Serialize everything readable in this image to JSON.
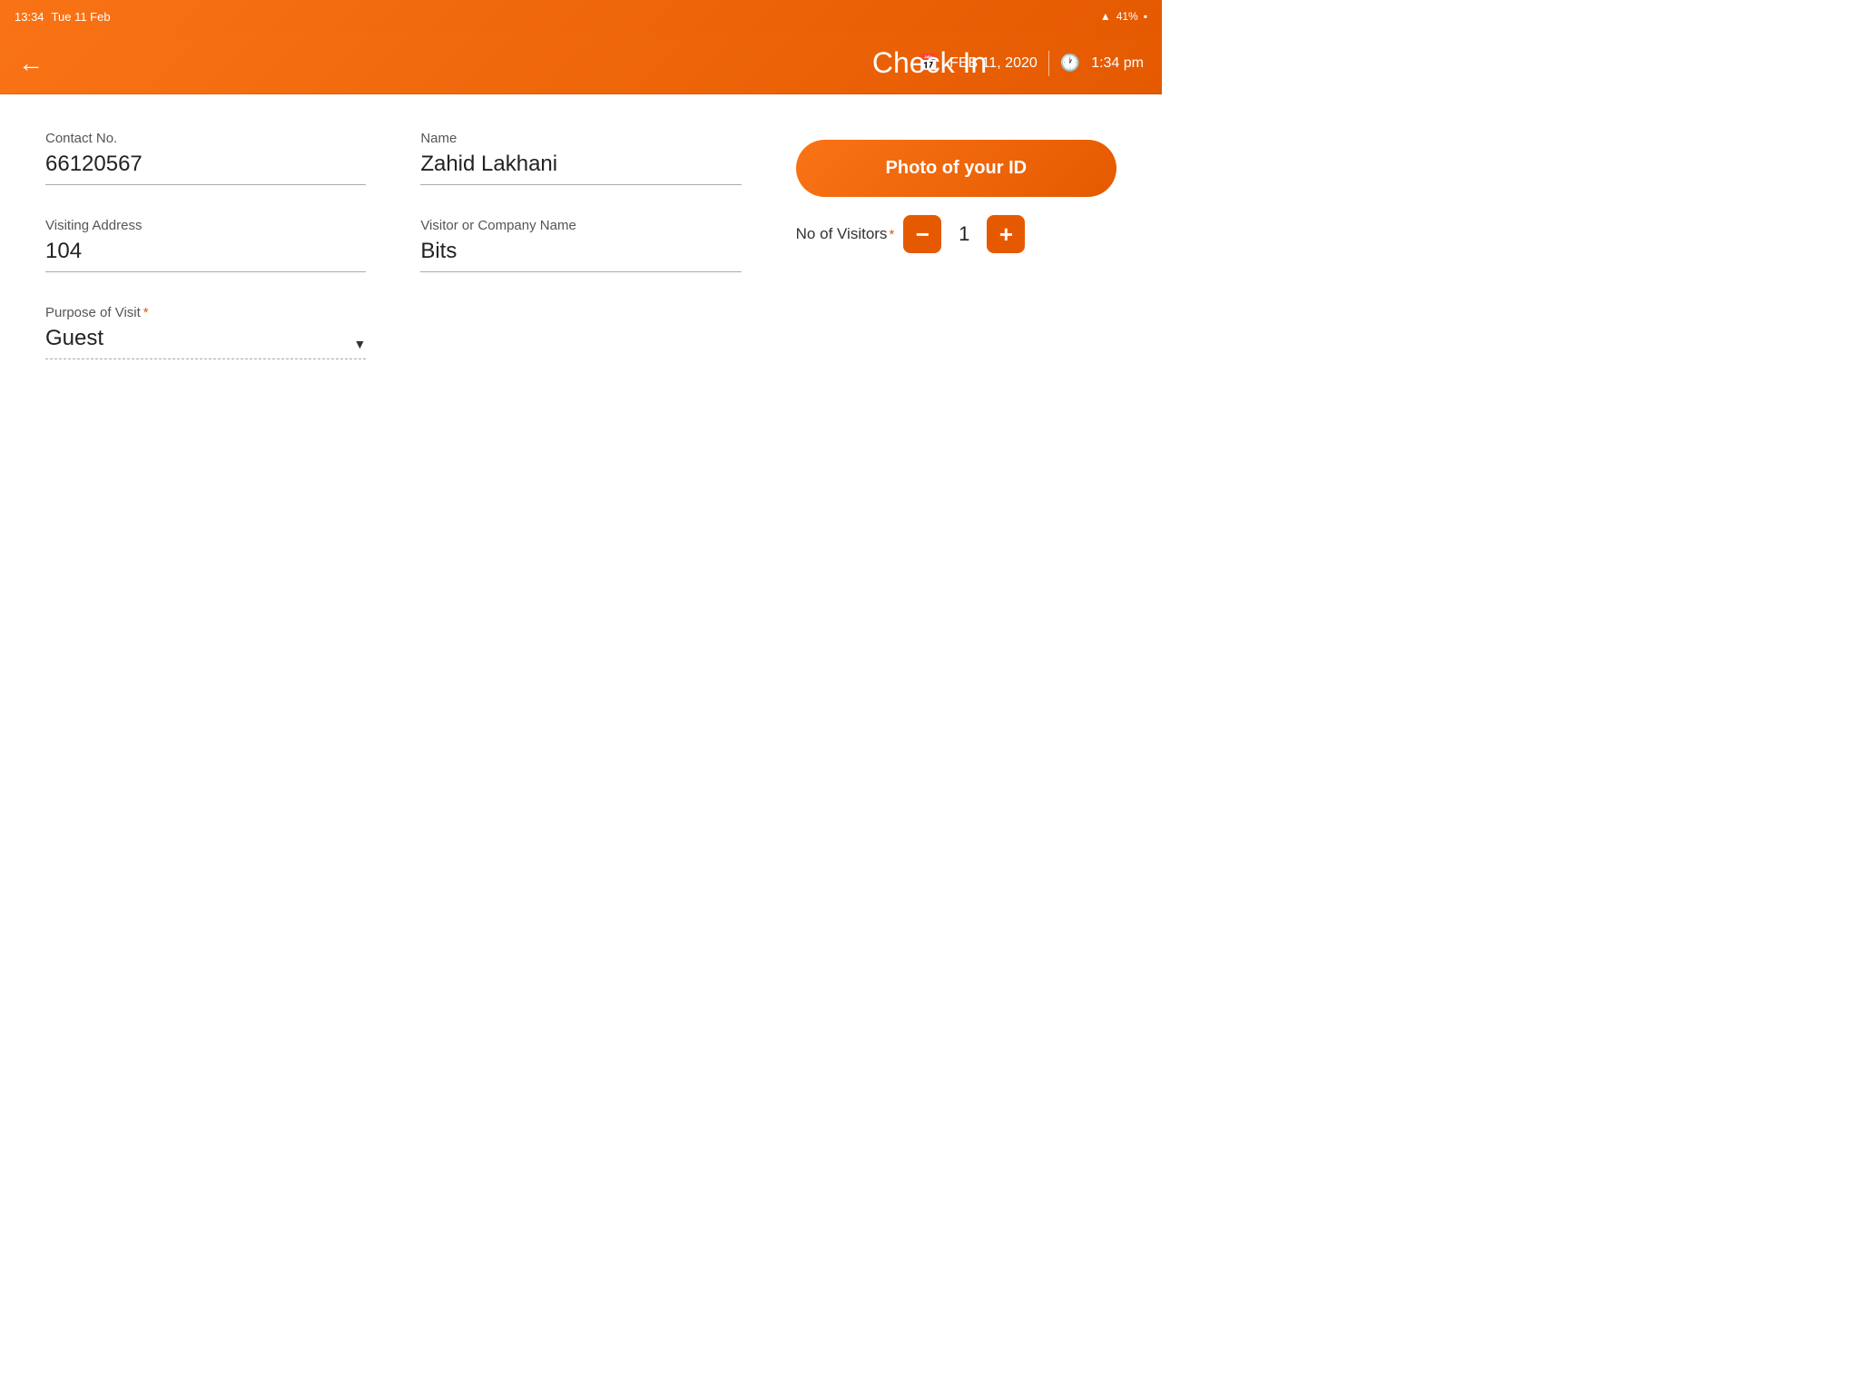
{
  "statusBar": {
    "time": "13:34",
    "day": "Tue 11 Feb",
    "wifi": "wifi-icon",
    "battery": "41%"
  },
  "header": {
    "title": "Check In",
    "backLabel": "←",
    "date": "FEB 11, 2020",
    "time": "1:34 pm",
    "calendarIcon": "📅",
    "clockIcon": "🕐"
  },
  "form": {
    "contactNo": {
      "label": "Contact No.",
      "value": "66120567"
    },
    "name": {
      "label": "Name",
      "value": "Zahid Lakhani"
    },
    "photoIdBtn": {
      "label": "Photo of your ID"
    },
    "visitingAddress": {
      "label": "Visiting Address",
      "value": "104"
    },
    "visitorOrCompanyName": {
      "label": "Visitor or Company Name",
      "value": "Bits"
    },
    "noOfVisitors": {
      "label": "No of Visitors",
      "required": "*",
      "value": "1",
      "decrementLabel": "−",
      "incrementLabel": "+"
    },
    "purposeOfVisit": {
      "label": "Purpose of Visit",
      "required": "*",
      "value": "Guest"
    }
  },
  "colors": {
    "accent": "#f97316",
    "accentDark": "#e55a00"
  }
}
